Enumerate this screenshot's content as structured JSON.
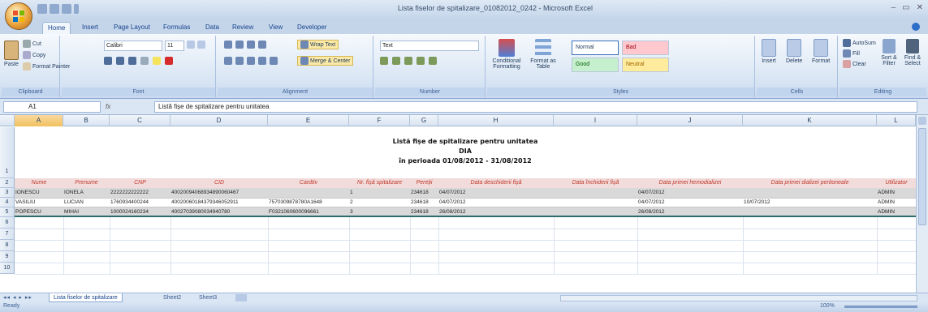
{
  "window": {
    "title": "Lista fiselor de spitalizare_01082012_0242 - Microsoft Excel",
    "controls": [
      "–",
      "▭",
      "✕"
    ]
  },
  "tabs": [
    "Home",
    "Insert",
    "Page Layout",
    "Formulas",
    "Data",
    "Review",
    "View",
    "Developer"
  ],
  "ribbon": {
    "clipboard": {
      "paste": "Paste",
      "cut": "Cut",
      "copy": "Copy",
      "format_painter": "Format Painter",
      "label": "Clipboard"
    },
    "font": {
      "name": "Calibri",
      "size": "11",
      "label": "Font"
    },
    "alignment": {
      "wrap": "Wrap Text",
      "merge": "Merge & Center",
      "label": "Alignment"
    },
    "number": {
      "format": "Text",
      "label": "Number"
    },
    "styles": {
      "conditional": "Conditional Formatting",
      "format_table": "Format as Table",
      "normal": "Normal",
      "bad": "Bad",
      "good": "Good",
      "neutral": "Neutral",
      "label": "Styles"
    },
    "cells": {
      "insert": "Insert",
      "delete": "Delete",
      "format": "Format",
      "label": "Cells"
    },
    "editing": {
      "autosum": "AutoSum",
      "fill": "Fill",
      "clear": "Clear",
      "sort": "Sort & Filter",
      "find": "Find & Select",
      "label": "Editing"
    }
  },
  "formula_bar": {
    "name_box": "A1",
    "fx": "fx",
    "formula": "Listă fișe de spitalizare pentru unitatea"
  },
  "columns": [
    "A",
    "B",
    "C",
    "D",
    "E",
    "F",
    "G",
    "H",
    "I",
    "J",
    "K",
    "L"
  ],
  "rows": [
    "1",
    "2",
    "3",
    "4",
    "5",
    "6",
    "7",
    "8",
    "9",
    "10"
  ],
  "report_title": {
    "line1": "Listă fișe de spitalizare pentru unitatea",
    "line2": "DIA",
    "line3": "în perioada 01/08/2012 - 31/08/2012"
  },
  "headers": [
    "Nume",
    "Prenume",
    "CNP",
    "CID",
    "Cardtiv",
    "Nr. fișă spitalizare",
    "Pereții",
    "Data deschiderii fișă",
    "Data închiderii fișă",
    "Data primei hemodializei",
    "Data primei dializei peritoneale",
    "Utilizator"
  ],
  "data_rows": [
    [
      "IONESCU",
      "IONELA",
      "2222222222222",
      "40020094068934890060467",
      "",
      "1",
      "234618",
      "04/07/2012",
      "",
      "04/07/2012",
      "",
      "ADMIN"
    ],
    [
      "VASILIU",
      "LUCIAN",
      "1760934400244",
      "40020060184379346052911",
      "7570309878780A1648",
      "2",
      "234618",
      "04/07/2012",
      "",
      "04/07/2012",
      "10/07/2012",
      "ADMIN"
    ],
    [
      "POPESCU",
      "MIHAI",
      "1000024160234",
      "40027039080034940780",
      "F0321060600096661",
      "3",
      "234618",
      "26/08/2012",
      "",
      "26/08/2012",
      "",
      "ADMIN"
    ]
  ],
  "sheets": [
    "Lista fiselor de spitalizare",
    "Sheet2",
    "Sheet3"
  ],
  "status": {
    "ready": "Ready",
    "zoom": "100%"
  },
  "colors": {
    "header_fill": "#f2dcdb",
    "header_text": "#c0392b",
    "row_fill_gray": "#d9d9d9",
    "row_fill_white": "#ffffff"
  }
}
